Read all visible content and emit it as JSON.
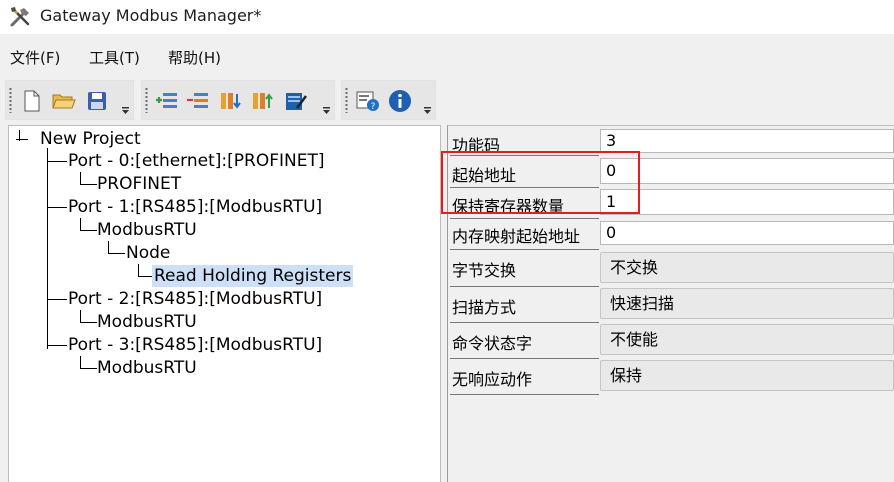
{
  "window": {
    "title": "Gateway Modbus Manager*"
  },
  "menu": {
    "items": [
      {
        "label": "文件(F)"
      },
      {
        "label": "工具(T)"
      },
      {
        "label": "帮助(H)"
      }
    ]
  },
  "toolbar": {
    "groups": [
      {
        "icons": [
          "new-file-icon",
          "open-folder-icon",
          "save-icon"
        ]
      },
      {
        "icons": [
          "add-item-icon",
          "remove-item-icon",
          "import-icon",
          "export-icon",
          "edit-notes-icon"
        ]
      },
      {
        "icons": [
          "help-topics-icon",
          "info-icon"
        ]
      }
    ]
  },
  "tree": {
    "root": "New Project",
    "nodes": [
      {
        "label": "Port - 0:[ethernet]:[PROFINET]"
      },
      {
        "label": "PROFINET"
      },
      {
        "label": "Port - 1:[RS485]:[ModbusRTU]"
      },
      {
        "label": "ModbusRTU"
      },
      {
        "label": "Node"
      },
      {
        "label": "Read Holding Registers"
      },
      {
        "label": "Port - 2:[RS485]:[ModbusRTU]"
      },
      {
        "label": "ModbusRTU"
      },
      {
        "label": "Port - 3:[RS485]:[ModbusRTU]"
      },
      {
        "label": "ModbusRTU"
      }
    ],
    "selected": "Read Holding Registers"
  },
  "properties": [
    {
      "label": "功能码",
      "value": "3"
    },
    {
      "label": "起始地址",
      "value": "0"
    },
    {
      "label": "保持寄存器数量",
      "value": "1"
    },
    {
      "label": "内存映射起始地址",
      "value": "0"
    },
    {
      "label": "字节交换",
      "value": "不交换"
    },
    {
      "label": "扫描方式",
      "value": "快速扫描"
    },
    {
      "label": "命令状态字",
      "value": "不使能"
    },
    {
      "label": "无响应动作",
      "value": "保持"
    }
  ],
  "colors": {
    "highlight": "#e02020",
    "selection": "#cde0f7"
  }
}
